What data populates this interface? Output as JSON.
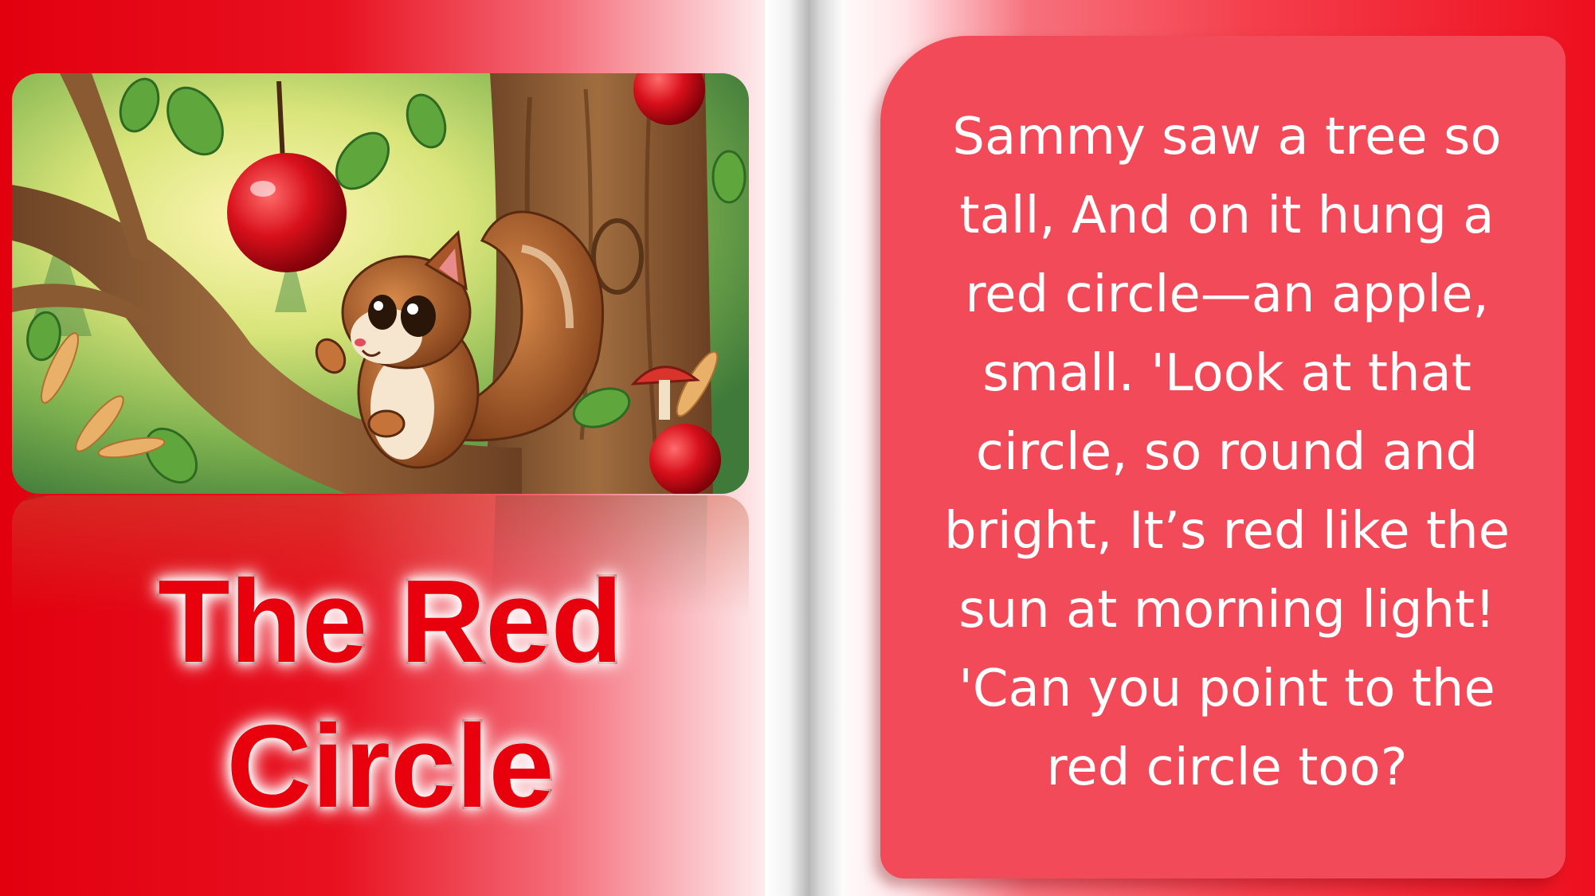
{
  "title": {
    "line1": "The Red",
    "line2": "Circle"
  },
  "story": {
    "text": "Sammy saw a tree so tall, And on it hung a red circle—an apple, small. 'Look at that circle, so round and bright, It’s red like the sun at morning light! 'Can you point to the red circle too?"
  },
  "illustration": {
    "subject": "squirrel-on-branch-looking-at-red-apple"
  },
  "colors": {
    "accent_red": "#e8000d",
    "card_red": "#f34a59",
    "title_outline": "#7a0000"
  }
}
